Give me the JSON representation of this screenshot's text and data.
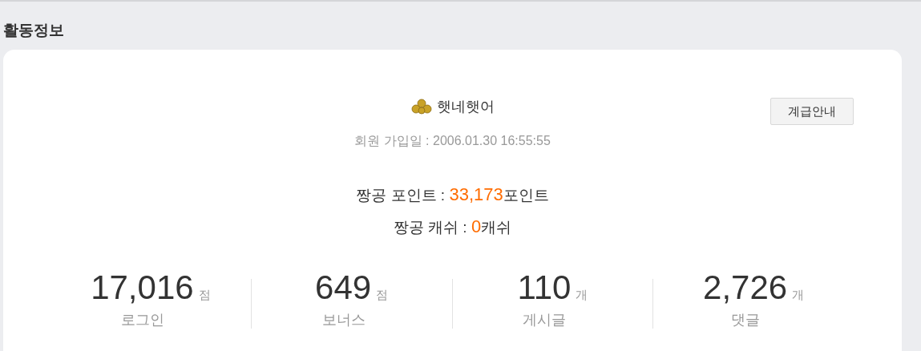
{
  "section_title": "활동정보",
  "profile": {
    "name": "햇네햇어",
    "join_date": "회원 가입일 : 2006.01.30 16:55:55",
    "grade_button": "계급안내"
  },
  "balances": [
    {
      "label": "짱공 포인트 : ",
      "value": "33,173",
      "unit": "포인트"
    },
    {
      "label": "짱공 캐쉬 : ",
      "value": "0",
      "unit": "캐쉬"
    }
  ],
  "stats": [
    {
      "value": "17,016",
      "unit": "점",
      "label": "로그인"
    },
    {
      "value": "649",
      "unit": "점",
      "label": "보너스"
    },
    {
      "value": "110",
      "unit": "개",
      "label": "게시글"
    },
    {
      "value": "2,726",
      "unit": "개",
      "label": "댓글"
    }
  ]
}
